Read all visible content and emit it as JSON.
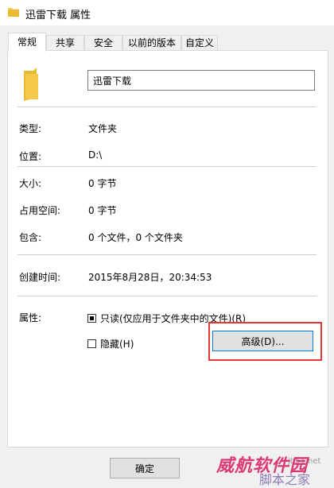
{
  "window": {
    "title": "迅雷下载 属性"
  },
  "tabs": [
    {
      "label": "常规",
      "active": true
    },
    {
      "label": "共享",
      "active": false
    },
    {
      "label": "安全",
      "active": false
    },
    {
      "label": "以前的版本",
      "active": false
    },
    {
      "label": "自定义",
      "active": false
    }
  ],
  "general": {
    "name": "迅雷下载",
    "type_label": "类型:",
    "type_value": "文件夹",
    "location_label": "位置:",
    "location_value": "D:\\",
    "size_label": "大小:",
    "size_value": "0 字节",
    "size_on_disk_label": "占用空间:",
    "size_on_disk_value": "0 字节",
    "contains_label": "包含:",
    "contains_value": "0 个文件，0 个文件夹",
    "created_label": "创建时间:",
    "created_value": "2015年8月28日，20:34:53",
    "attributes_label": "属性:",
    "readonly_label": "只读(仅应用于文件夹中的文件)(R)",
    "hidden_label": "隐藏(H)",
    "advanced_button": "高级(D)..."
  },
  "footer": {
    "ok_button": "确定"
  },
  "watermark": {
    "main": "威航软件园",
    "sub": "脚本之家",
    "url": "jb51.net"
  },
  "colors": {
    "folder": "#f3c84b",
    "highlight": "#e53935",
    "accent": "#0078d7"
  },
  "icons": {
    "title": "folder-icon",
    "big": "folder-icon"
  }
}
